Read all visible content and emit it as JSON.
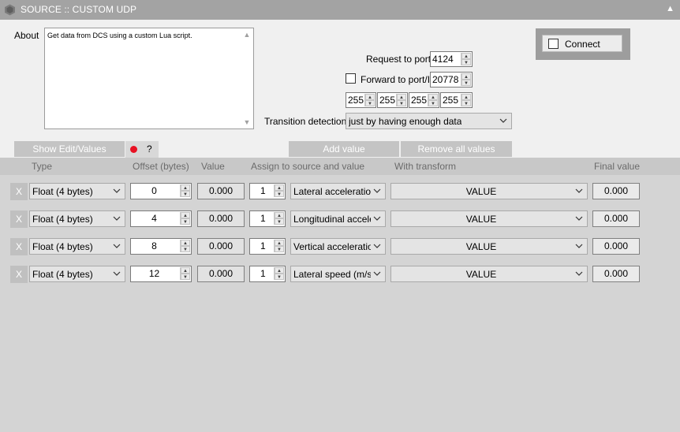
{
  "window": {
    "title": "SOURCE :: CUSTOM UDP",
    "collapse_glyph": "▲"
  },
  "about": {
    "label": "About",
    "text": "Get data from DCS using a custom Lua script."
  },
  "network": {
    "request_label": "Request to port",
    "request_port": "4124",
    "forward_label": "Forward to port/IP",
    "forward_checked": false,
    "forward_port": "20778",
    "ip": [
      "255",
      "255",
      "255",
      "255"
    ]
  },
  "transition": {
    "label": "Transition detection",
    "value": "just by having enough data"
  },
  "connect": {
    "label": "Connect",
    "checked": false
  },
  "toolbar": {
    "show_edit": "Show Edit/Values",
    "help": "?",
    "status_color": "#e81123",
    "add_value": "Add value",
    "remove_all": "Remove all values"
  },
  "columns": {
    "type": "Type",
    "offset": "Offset (bytes)",
    "value": "Value",
    "assign": "Assign to source and value",
    "transform": "With transform",
    "final": "Final value"
  },
  "rows": [
    {
      "remove": "X",
      "type": "Float (4 bytes)",
      "offset": "0",
      "value": "0.000",
      "index": "1",
      "assign": "Lateral acceleration (",
      "transform": "VALUE",
      "final": "0.000"
    },
    {
      "remove": "X",
      "type": "Float (4 bytes)",
      "offset": "4",
      "value": "0.000",
      "index": "1",
      "assign": "Longitudinal accelera",
      "transform": "VALUE",
      "final": "0.000"
    },
    {
      "remove": "X",
      "type": "Float (4 bytes)",
      "offset": "8",
      "value": "0.000",
      "index": "1",
      "assign": "Vertical acceleration",
      "transform": "VALUE",
      "final": "0.000"
    },
    {
      "remove": "X",
      "type": "Float (4 bytes)",
      "offset": "12",
      "value": "0.000",
      "index": "1",
      "assign": "Lateral speed (m/s)",
      "transform": "VALUE",
      "final": "0.000"
    }
  ]
}
